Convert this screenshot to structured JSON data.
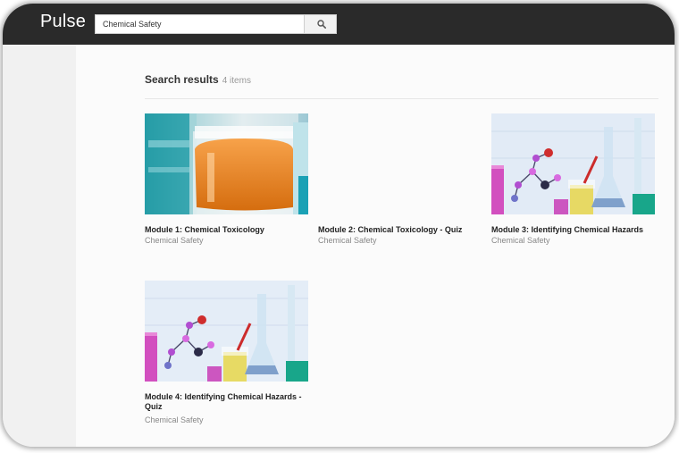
{
  "header": {
    "brand": "Pulse",
    "search_value": "Chemical Safety"
  },
  "icons": {
    "search": "search-icon"
  },
  "results": {
    "heading": "Search results",
    "count": "4 items"
  },
  "modules": [
    {
      "title": "Module 1: Chemical Toxicology",
      "subtitle": "Chemical Safety"
    },
    {
      "title": "Module 2: Chemical Toxicology - Quiz",
      "subtitle": "Chemical Safety"
    },
    {
      "title": "Module 3: Identifying Chemical Hazards",
      "subtitle": "Chemical Safety"
    },
    {
      "title": "Module 4: Identifying Chemical Hazards - Quiz",
      "subtitle": "Chemical Safety"
    }
  ]
}
